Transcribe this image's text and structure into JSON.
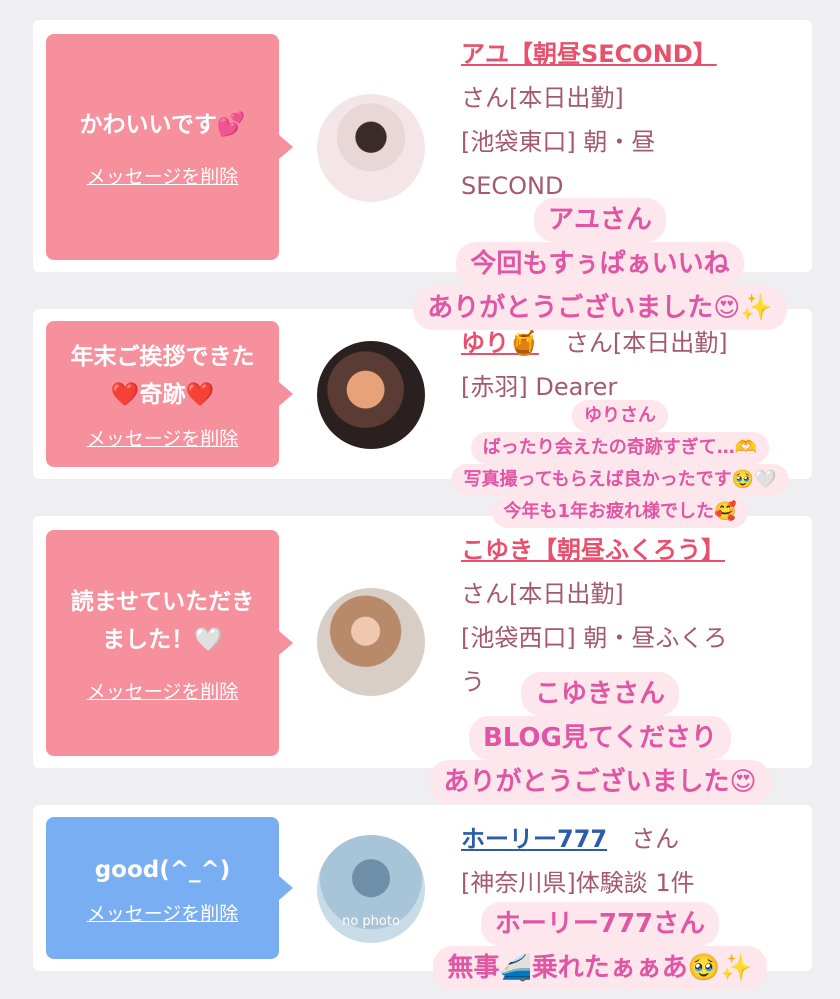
{
  "delete_label": "メッセージを削除",
  "cards": [
    {
      "bubble_text": "かわいいです💕",
      "name": "アユ【朝昼SECOND】",
      "line1": "さん[本日出勤]",
      "line2": "[池袋東口] 朝・昼",
      "line3": "SECOND",
      "overlay": [
        "アユさん",
        "今回もすぅぱぁいいね",
        "ありがとうございました😍✨"
      ]
    },
    {
      "bubble_text": "年末ご挨拶できた\n❤️奇跡❤️",
      "name": "ゆり🍯",
      "line1": "さん[本日出勤]",
      "line2": "[赤羽] Dearer",
      "overlay": [
        "ゆりさん",
        "ばったり会えたの奇跡すぎて…🫶",
        "写真撮ってもらえば良かったです🥹🤍",
        "今年も1年お疲れ様でした🥰"
      ]
    },
    {
      "bubble_text": "読ませていただき\nました！🤍",
      "name": "こゆき【朝昼ふくろう】",
      "line1": "さん[本日出勤]",
      "line2": "[池袋西口] 朝・昼ふくろ",
      "line3": "う",
      "overlay": [
        "こゆきさん",
        "BLOG見てくださり",
        "ありがとうございました😍"
      ]
    },
    {
      "bubble_text": "good(^_^)",
      "name": "ホーリー777",
      "line1": "さん",
      "line2": "[神奈川県]体験談 1件",
      "avatar_text": "no photo",
      "overlay": [
        "ホーリー777さん",
        "無事🚄乗れたぁぁあ🥹✨"
      ]
    }
  ]
}
